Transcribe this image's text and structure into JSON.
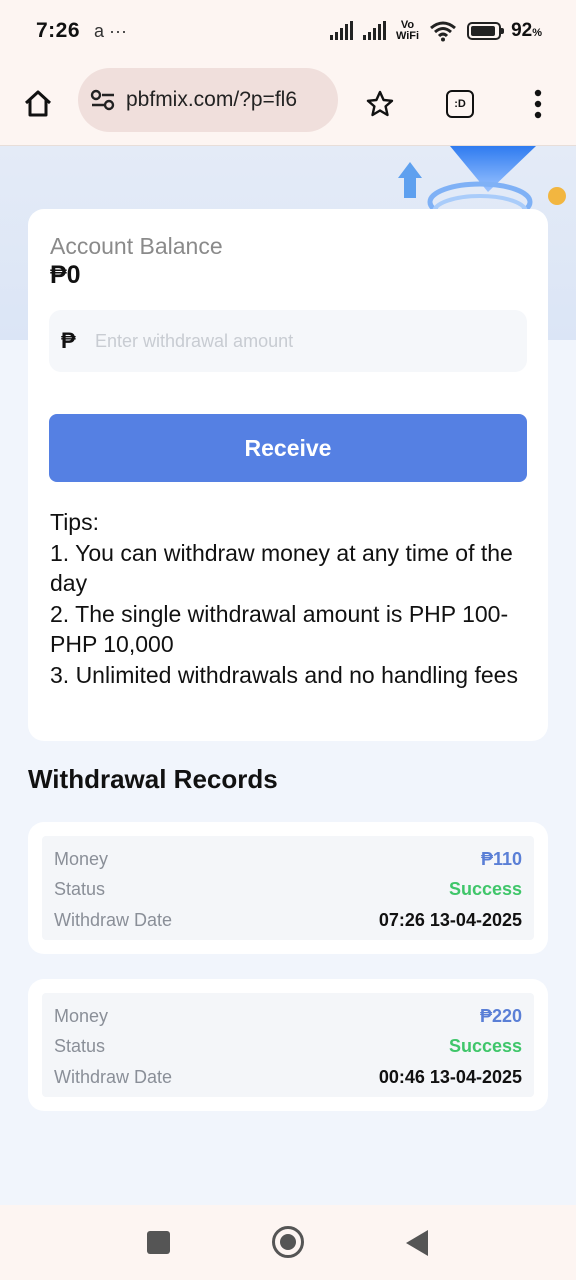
{
  "status_bar": {
    "time": "7:26",
    "notif_glyphs": "a ···",
    "vowifi_top": "Vo",
    "vowifi_bottom": "WiFi",
    "battery_percent": "92",
    "battery_unit": "%",
    "battery_level": 0.92
  },
  "browser": {
    "url": "pbfmix.com/?p=fl6",
    "tab_label": ":D"
  },
  "balance": {
    "label": "Account Balance",
    "value": "₱0"
  },
  "withdraw": {
    "currency_symbol": "₱",
    "placeholder": "Enter withdrawal amount",
    "receive_label": "Receive"
  },
  "tips": {
    "title": "Tips:",
    "items": [
      "1. You can withdraw money at any time of the day",
      "2. The single withdrawal amount is PHP 100-PHP 10,000",
      "3. Unlimited withdrawals and no handling fees"
    ]
  },
  "records": {
    "title": "Withdrawal Records",
    "money_label": "Money",
    "status_label": "Status",
    "date_label": "Withdraw Date",
    "items": [
      {
        "money": "₱110",
        "status": "Success",
        "date": "07:26 13-04-2025"
      },
      {
        "money": "₱220",
        "status": "Success",
        "date": "00:46 13-04-2025"
      }
    ]
  },
  "colors": {
    "accent": "#5580e3",
    "success": "#3fc66a",
    "money": "#5a7fd6"
  }
}
